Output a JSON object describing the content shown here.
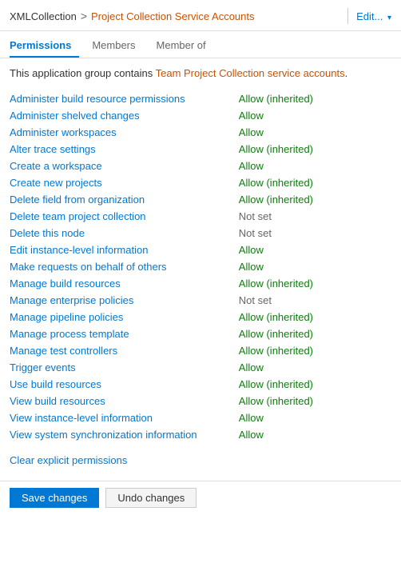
{
  "header": {
    "collection": "XMLCollection",
    "separator": ">",
    "page": "Project Collection Service Accounts",
    "edit_label": "Edit...",
    "dropdown_icon": "▾"
  },
  "tabs": [
    {
      "label": "Permissions",
      "active": true
    },
    {
      "label": "Members",
      "active": false
    },
    {
      "label": "Member of",
      "active": false
    }
  ],
  "info": {
    "prefix": "This application group contains ",
    "highlight": "Team Project Collection service accounts",
    "suffix": "."
  },
  "permissions": [
    {
      "name": "Administer build resource permissions",
      "value": "Allow (inherited)",
      "type": "allow-inherited"
    },
    {
      "name": "Administer shelved changes",
      "value": "Allow",
      "type": "allow"
    },
    {
      "name": "Administer workspaces",
      "value": "Allow",
      "type": "allow"
    },
    {
      "name": "Alter trace settings",
      "value": "Allow (inherited)",
      "type": "allow-inherited"
    },
    {
      "name": "Create a workspace",
      "value": "Allow",
      "type": "allow"
    },
    {
      "name": "Create new projects",
      "value": "Allow (inherited)",
      "type": "allow-inherited"
    },
    {
      "name": "Delete field from organization",
      "value": "Allow (inherited)",
      "type": "allow-inherited"
    },
    {
      "name": "Delete team project collection",
      "value": "Not set",
      "type": "not-set"
    },
    {
      "name": "Delete this node",
      "value": "Not set",
      "type": "not-set"
    },
    {
      "name": "Edit instance-level information",
      "value": "Allow",
      "type": "allow"
    },
    {
      "name": "Make requests on behalf of others",
      "value": "Allow",
      "type": "allow"
    },
    {
      "name": "Manage build resources",
      "value": "Allow (inherited)",
      "type": "allow-inherited"
    },
    {
      "name": "Manage enterprise policies",
      "value": "Not set",
      "type": "not-set"
    },
    {
      "name": "Manage pipeline policies",
      "value": "Allow (inherited)",
      "type": "allow-inherited"
    },
    {
      "name": "Manage process template",
      "value": "Allow (inherited)",
      "type": "allow-inherited"
    },
    {
      "name": "Manage test controllers",
      "value": "Allow (inherited)",
      "type": "allow-inherited"
    },
    {
      "name": "Trigger events",
      "value": "Allow",
      "type": "allow"
    },
    {
      "name": "Use build resources",
      "value": "Allow (inherited)",
      "type": "allow-inherited"
    },
    {
      "name": "View build resources",
      "value": "Allow (inherited)",
      "type": "allow-inherited"
    },
    {
      "name": "View instance-level information",
      "value": "Allow",
      "type": "allow"
    },
    {
      "name": "View system synchronization information",
      "value": "Allow",
      "type": "allow"
    }
  ],
  "clear_link": "Clear explicit permissions",
  "footer": {
    "save_label": "Save changes",
    "undo_label": "Undo changes"
  }
}
